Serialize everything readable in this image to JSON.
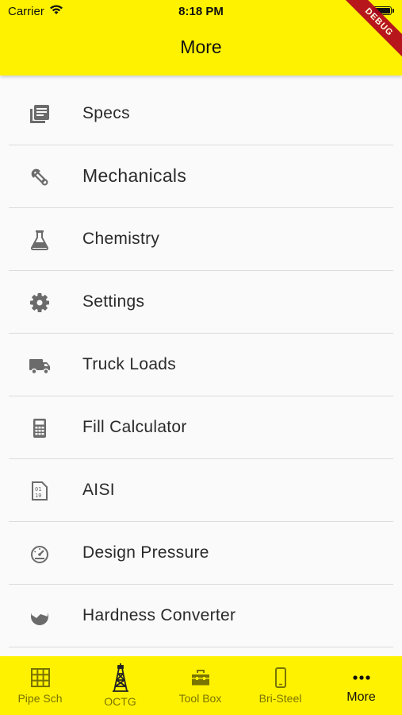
{
  "status_bar": {
    "carrier": "Carrier",
    "time": "8:18 PM"
  },
  "app_bar": {
    "title": "More",
    "debug_banner": "DEBUG"
  },
  "menu": {
    "items": [
      {
        "label": "Specs",
        "icon": "library-books-icon"
      },
      {
        "label": "Mechanicals",
        "icon": "wrench-icon"
      },
      {
        "label": "Chemistry",
        "icon": "flask-icon"
      },
      {
        "label": "Settings",
        "icon": "gear-icon"
      },
      {
        "label": "Truck Loads",
        "icon": "truck-icon"
      },
      {
        "label": "Fill Calculator",
        "icon": "calculator-icon"
      },
      {
        "label": "AISI",
        "icon": "sim-card-icon"
      },
      {
        "label": "Design Pressure",
        "icon": "gauge-icon"
      },
      {
        "label": "Hardness Converter",
        "icon": "landscape-circle-icon"
      }
    ]
  },
  "tabs": [
    {
      "label": "Pipe Sch",
      "icon": "grid-icon"
    },
    {
      "label": "OCTG",
      "icon": "oil-derrick-icon"
    },
    {
      "label": "Tool Box",
      "icon": "toolbox-icon"
    },
    {
      "label": "Bri-Steel",
      "icon": "phone-icon"
    },
    {
      "label": "More",
      "icon": "more-dots-icon",
      "active": true
    }
  ],
  "colors": {
    "accent": "#fff200",
    "icon_gray": "#6b6b6b",
    "inactive_tab": "#7a7400",
    "debug": "#b00020"
  }
}
